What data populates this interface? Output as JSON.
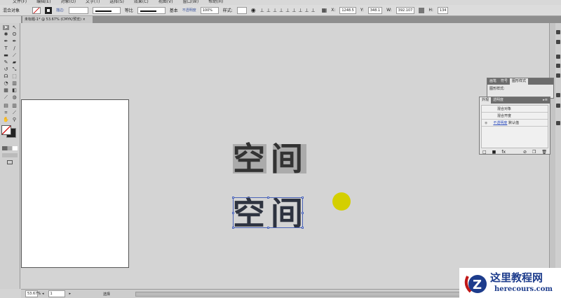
{
  "menu": [
    "文件(F)",
    "编辑(E)",
    "对象(O)",
    "文字(T)",
    "选择(S)",
    "效果(C)",
    "视图(V)",
    "窗口(W)",
    "帮助(H)"
  ],
  "control": {
    "selection_label": "混合对象",
    "stroke_label": "描边:",
    "stroke_profile": "等比",
    "brush": "基本",
    "opacity_label": "不透明度",
    "opacity": "100%",
    "style_label": "样式:",
    "x": "1248.5",
    "y": "348.1",
    "w": "392.107",
    "h": "134"
  },
  "document": {
    "tab": "未标题-1* @ 53.67% (CMYK/预览)"
  },
  "artwork": {
    "text_top": "空间",
    "text_bottom": "空间",
    "circle_color": "#d4cf00"
  },
  "panels": {
    "back_tabs": [
      "画笔",
      "符号",
      "图形样式"
    ],
    "back_label": "图形样式:",
    "front_tabs": [
      "外观",
      "透明度"
    ],
    "rows": [
      "混合对象",
      "混合开度"
    ],
    "opacity_row_link": "不透明度",
    "opacity_row_value": "默认值"
  },
  "status": {
    "zoom": "53.67%",
    "page": "1",
    "tool": "选择"
  },
  "watermark": {
    "title": "这里教程网",
    "url": "herecours.com"
  }
}
